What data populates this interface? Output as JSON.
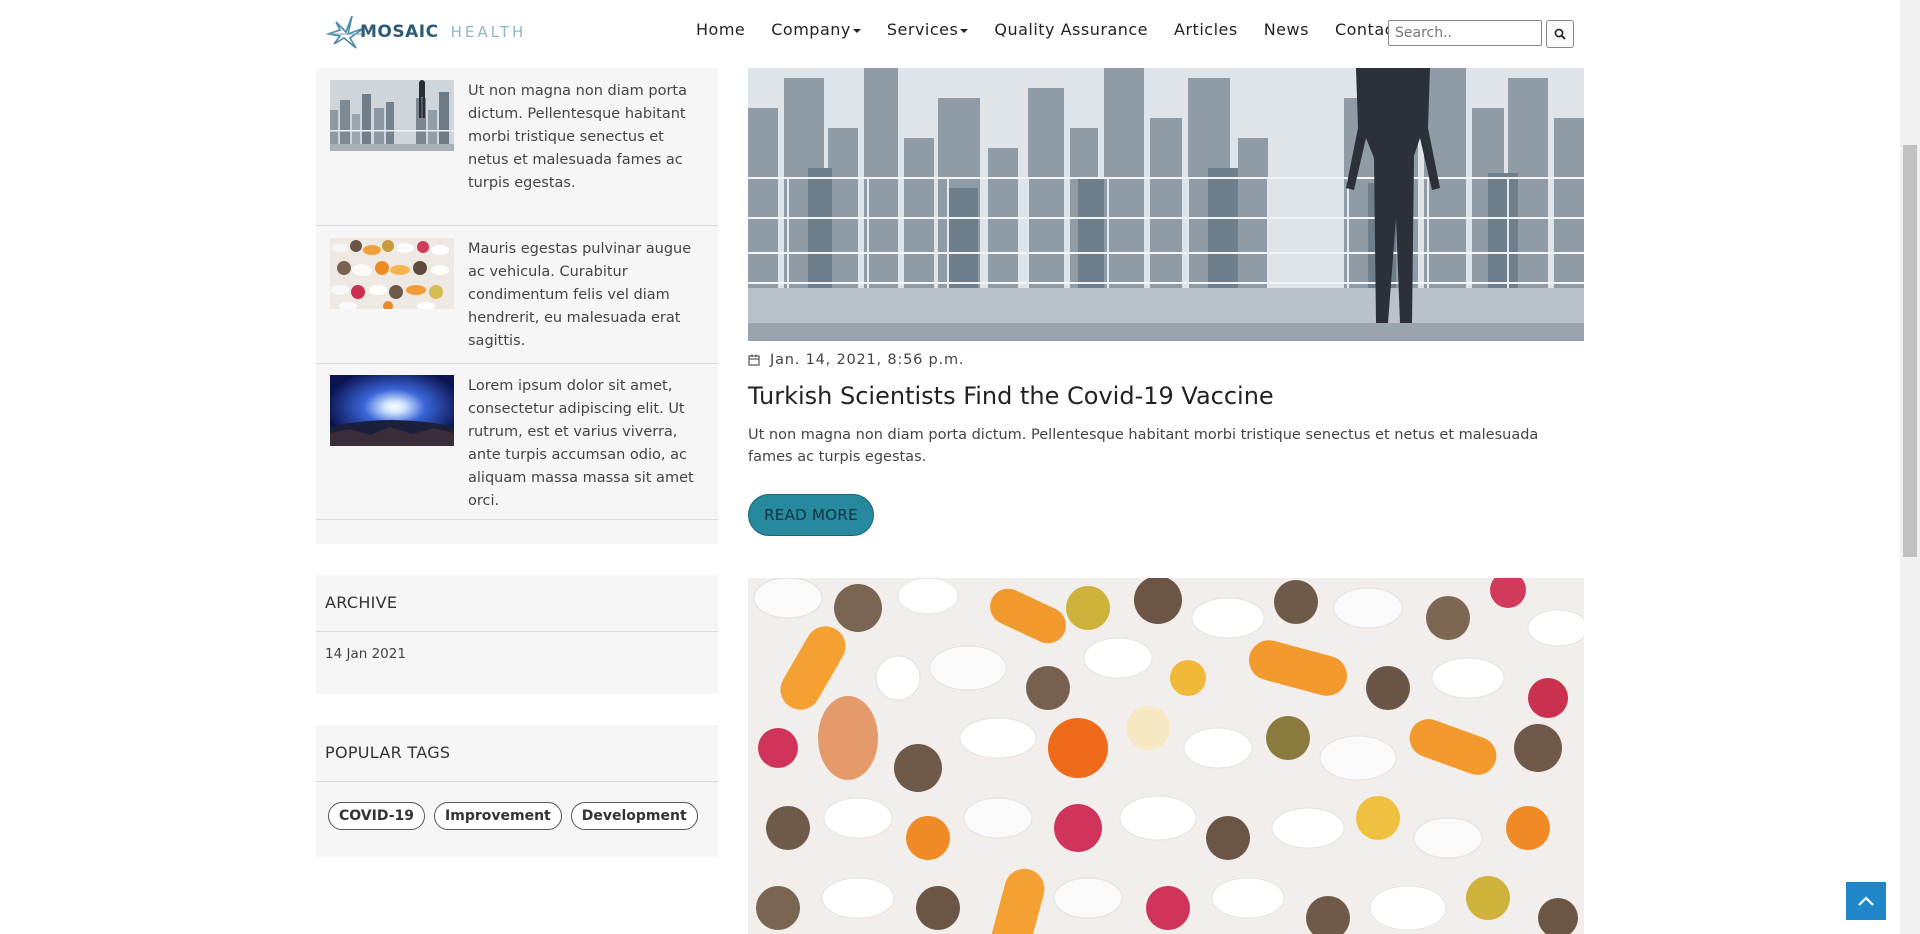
{
  "brand": {
    "name_part1": "MOSAIC",
    "name_part2": "HEALTH"
  },
  "nav": {
    "items": [
      {
        "label": "Home",
        "dropdown": false
      },
      {
        "label": "Company",
        "dropdown": true
      },
      {
        "label": "Services",
        "dropdown": true
      },
      {
        "label": "Quality Assurance",
        "dropdown": false
      },
      {
        "label": "Articles",
        "dropdown": false
      },
      {
        "label": "News",
        "dropdown": false
      },
      {
        "label": "Contact",
        "dropdown": false
      }
    ],
    "search_placeholder": "Search.."
  },
  "sidebar": {
    "recent_posts": [
      {
        "image": "city-skyline-man",
        "text": "Ut non magna non diam porta dictum. Pellentesque habitant morbi tristique senectus et netus et malesuada fames ac turpis egestas."
      },
      {
        "image": "pills",
        "text": "Mauris egestas pulvinar augue ac vehicula. Curabitur condimentum felis vel diam hendrerit, eu malesuada erat sagittis."
      },
      {
        "image": "space-planet",
        "text": "Lorem ipsum dolor sit amet, consectetur adipiscing elit. Ut rutrum, est et varius viverra, ante turpis accumsan odio, ac aliquam massa massa sit amet orci."
      }
    ],
    "archive": {
      "title": "ARCHIVE",
      "items": [
        "14 Jan 2021"
      ]
    },
    "tags": {
      "title": "POPULAR TAGS",
      "items": [
        "COVID-19",
        "Improvement",
        "Development"
      ]
    }
  },
  "main": {
    "post": {
      "date": "Jan. 14, 2021, 8:56 p.m.",
      "title": "Turkish Scientists Find the Covid-19 Vaccine",
      "excerpt": "Ut non magna non diam porta dictum. Pellentesque habitant morbi tristique senectus et netus et malesuada fames ac turpis egestas.",
      "read_more": "READ MORE"
    }
  },
  "colors": {
    "accent": "#27899e",
    "back_to_top": "#1f86c9"
  }
}
